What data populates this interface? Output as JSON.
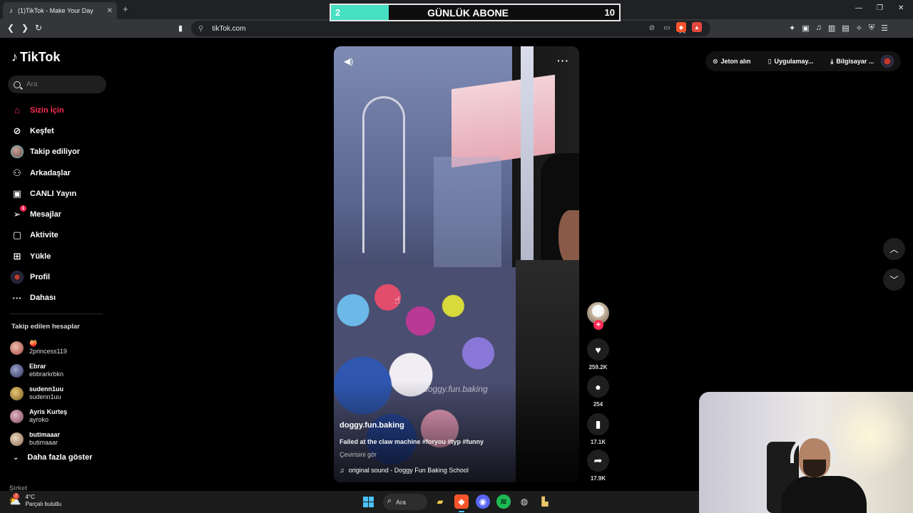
{
  "browser": {
    "tab_title": "(1)TikTok - Make Your Day",
    "url": "tikTok.com"
  },
  "overlay": {
    "current": "2",
    "label": "GÜNLÜK ABONE",
    "goal": "10",
    "progress_fraction": 0.2
  },
  "tiktok": {
    "logo": "TikTok",
    "search_placeholder": "Ara",
    "nav": [
      {
        "label": "Sizin İçin",
        "icon": "home-icon",
        "active": true
      },
      {
        "label": "Keşfet",
        "icon": "compass-icon"
      },
      {
        "label": "Takip ediliyor",
        "icon": "avatar-icon"
      },
      {
        "label": "Arkadaşlar",
        "icon": "friends-icon"
      },
      {
        "label": "CANLI Yayın",
        "icon": "live-tv-icon"
      },
      {
        "label": "Mesajlar",
        "icon": "paper-plane-icon",
        "badge": "1"
      },
      {
        "label": "Aktivite",
        "icon": "message-box-icon"
      },
      {
        "label": "Yükle",
        "icon": "plus-box-icon"
      },
      {
        "label": "Profil",
        "icon": "profile-avatar-icon"
      },
      {
        "label": "Dahası",
        "icon": "more-dots-icon"
      }
    ],
    "following_title": "Takip edilen hesaplar",
    "following": [
      {
        "name": "🍑",
        "handle": "2princess119"
      },
      {
        "name": "Ebrar",
        "handle": "ebbrarkrbkn"
      },
      {
        "name": "sudenn1uu",
        "handle": "sudenn1uu"
      },
      {
        "name": "Ayris Kurteş",
        "handle": "ayroko"
      },
      {
        "name": "butimaaar",
        "handle": "butimaaar"
      }
    ],
    "show_more": "Daha fazla göster",
    "company": "Şirket",
    "top_links": {
      "coins": "Jeton alın",
      "app": "Uygulamay...",
      "desktop": "Bilgisayar ..."
    }
  },
  "video": {
    "watermark": "@doggy.fun.baking",
    "author": "doggy.fun.baking",
    "caption": "Failed at the claw machine #foryou #typ #funny",
    "translate": "Çevirisini gör",
    "sound": "original sound - Doggy Fun Baking School",
    "likes": "259.2K",
    "comments": "254",
    "saves": "17.1K",
    "shares": "17.9K"
  },
  "taskbar": {
    "temp": "4°C",
    "weather": "Parçalı bulutlu",
    "weather_badge": "2",
    "search": "Ara"
  },
  "colors": {
    "accent": "#fe2c55",
    "progress": "#46e0c3"
  }
}
